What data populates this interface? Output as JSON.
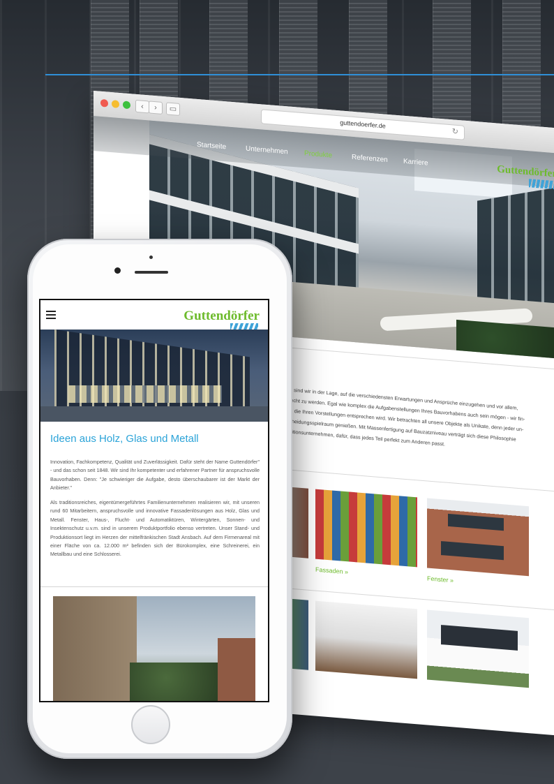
{
  "browser": {
    "url": "guttendoerfer.de"
  },
  "site": {
    "nav": [
      "Startseite",
      "Unternehmen",
      "Produkte",
      "Referenzen",
      "Karriere"
    ],
    "active_nav": "Produkte",
    "logo": "Guttendörfer",
    "body_lines": [
      "g. Dadurch sind wir in der Lage, auf die verschiedensten Erwartungen und Ansprüche einzugehen und vor allem,",
      "ungen gerecht zu werden. Egal wie komplex die Aufgabenstellungen Ihres Bauvorhabens auch sein mögen - wir fin-",
      "he Lösung, die Ihren Vorstellungen entsprechen wird. Wir betrachten all unsere Objekte als Unikate, denn jeder un-",
      "cher Entscheidungsspielraum genießen. Mit Massenfertigung auf Bauzatzniveau verträgt sich diese Philosophie",
      "acher Traditionsunternehmen, dafür, dass jedes Teil perfekt zum Anderen passt."
    ],
    "products": [
      {
        "label": "Fassaden »"
      },
      {
        "label": "Fenster »"
      }
    ]
  },
  "mobile": {
    "logo": "Guttendörfer",
    "title": "Ideen aus Holz, Glas und Metall",
    "paragraph1": "Innovation, Fachkompetenz, Qualität und Zuverlässigkeit. Dafür steht der Name Guttendörfer\" - und das schon seit 1848. Wir sind Ihr kompetenter und erfahrener Partner für anspruchsvolle Bauvorhaben. Denn: \"Je schwieriger die Aufgabe, desto überschaubarer ist der Markt der Anbieter.\"",
    "paragraph2": "Als traditionsreiches, eigentümergeführtes Familienunternehmen realisieren wir, mit unseren rund 60 Mitarbeitern, anspruchsvolle und innovative Fassadenlösungen aus Holz, Glas und Metall. Fenster, Haus-, Flucht- und Automatiktüren, Wintergärten, Sonnen- und Insektenschutz u.v.m. sind in unserem Produktportfolio ebenso vertreten. Unser Stand- und Produktionsort liegt im Herzen der mittelfränkischen Stadt Ansbach. Auf dem Firmenareal mit einer Fläche von ca. 12.000 m² befinden sich der Bürokomplex, eine Schreinerei, ein Metallbau und eine Schlosserei."
  },
  "colors": {
    "brand_green": "#6dbb2c",
    "brand_blue": "#2aa3d8",
    "accent_line": "#2f8fd8"
  }
}
